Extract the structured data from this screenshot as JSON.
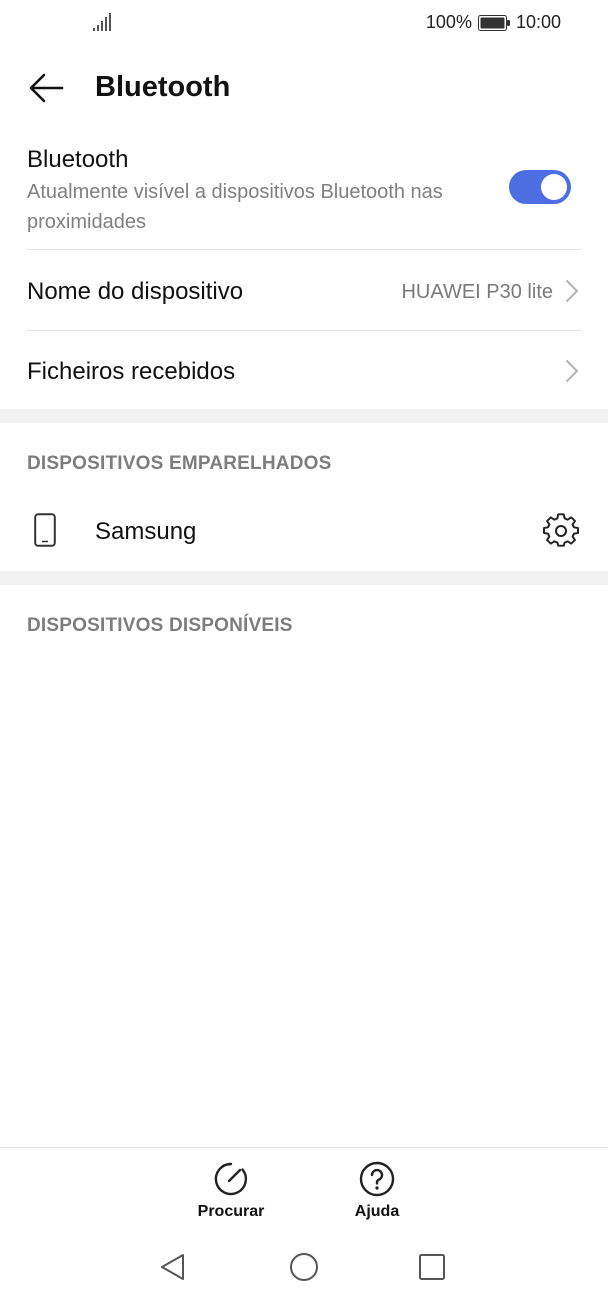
{
  "status_bar": {
    "battery_percent": "100%",
    "time": "10:00",
    "signal_icon": "signal-icon",
    "battery_icon": "battery-icon"
  },
  "header": {
    "title": "Bluetooth",
    "back_icon": "arrow-left-icon"
  },
  "bluetooth": {
    "title": "Bluetooth",
    "subtitle": "Atualmente visível a dispositivos Bluetooth nas proximidades",
    "enabled": true,
    "accent_color": "#4d6ee3"
  },
  "device_name": {
    "label": "Nome do dispositivo",
    "value": "HUAWEI P30 lite"
  },
  "received_files": {
    "label": "Ficheiros recebidos"
  },
  "paired": {
    "header": "DISPOSITIVOS EMPARELHADOS",
    "devices": [
      {
        "name": "Samsung",
        "icon": "phone-icon",
        "settings_icon": "gear-icon"
      }
    ]
  },
  "available": {
    "header": "DISPOSITIVOS DISPONÍVEIS"
  },
  "actions": {
    "search_label": "Procurar",
    "help_label": "Ajuda"
  }
}
